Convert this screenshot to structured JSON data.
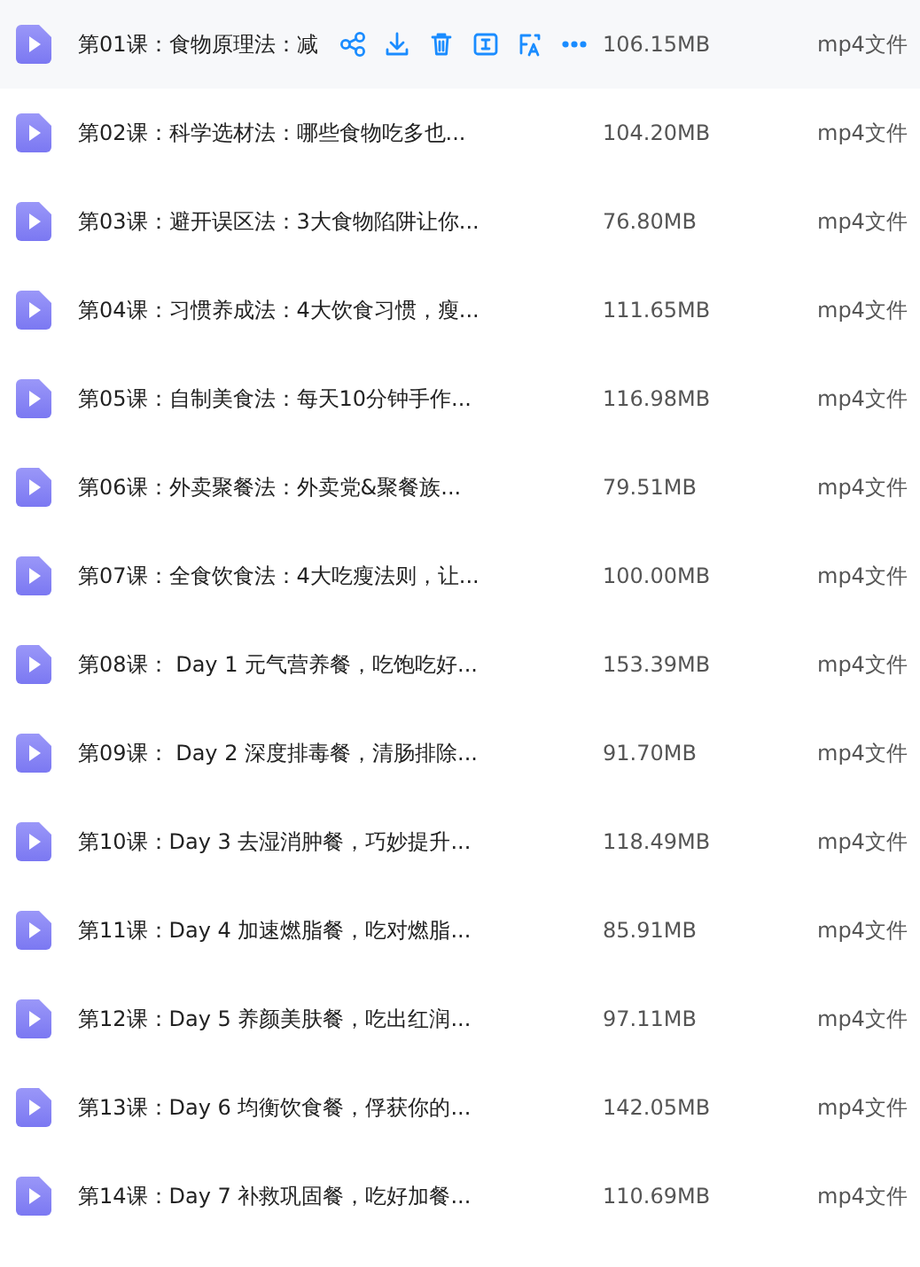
{
  "files": [
    {
      "name": "第01课：食物原理法：减",
      "size": "106.15MB",
      "type": "mp4文件",
      "hovered": true
    },
    {
      "name": "第02课：科学选材法：哪些食物吃多也...",
      "size": "104.20MB",
      "type": "mp4文件",
      "hovered": false
    },
    {
      "name": "第03课：避开误区法：3大食物陷阱让你...",
      "size": "76.80MB",
      "type": "mp4文件",
      "hovered": false
    },
    {
      "name": "第04课：习惯养成法：4大饮食习惯，瘦...",
      "size": "111.65MB",
      "type": "mp4文件",
      "hovered": false
    },
    {
      "name": "第05课：自制美食法：每天10分钟手作...",
      "size": "116.98MB",
      "type": "mp4文件",
      "hovered": false
    },
    {
      "name": "第06课：外卖聚餐法：外卖党&聚餐族...",
      "size": "79.51MB",
      "type": "mp4文件",
      "hovered": false
    },
    {
      "name": "第07课：全食饮食法：4大吃瘦法则，让...",
      "size": "100.00MB",
      "type": "mp4文件",
      "hovered": false
    },
    {
      "name": "第08课： Day 1 元气营养餐，吃饱吃好...",
      "size": "153.39MB",
      "type": "mp4文件",
      "hovered": false
    },
    {
      "name": "第09课： Day 2 深度排毒餐，清肠排除...",
      "size": "91.70MB",
      "type": "mp4文件",
      "hovered": false
    },
    {
      "name": "第10课：Day 3 去湿消肿餐，巧妙提升...",
      "size": "118.49MB",
      "type": "mp4文件",
      "hovered": false
    },
    {
      "name": "第11课：Day 4 加速燃脂餐，吃对燃脂...",
      "size": "85.91MB",
      "type": "mp4文件",
      "hovered": false
    },
    {
      "name": "第12课：Day 5 养颜美肤餐，吃出红润...",
      "size": "97.11MB",
      "type": "mp4文件",
      "hovered": false
    },
    {
      "name": "第13课：Day 6 均衡饮食餐，俘获你的...",
      "size": "142.05MB",
      "type": "mp4文件",
      "hovered": false
    },
    {
      "name": "第14课：Day 7 补救巩固餐，吃好加餐...",
      "size": "110.69MB",
      "type": "mp4文件",
      "hovered": false
    }
  ]
}
